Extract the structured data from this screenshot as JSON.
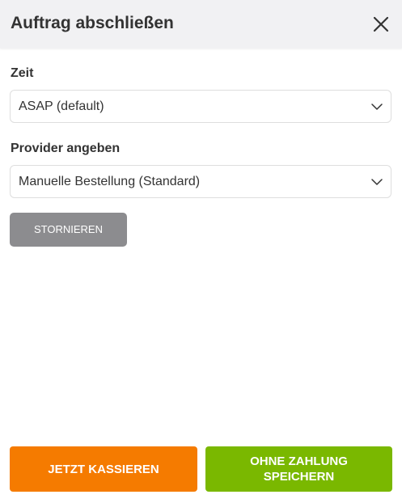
{
  "header": {
    "title": "Auftrag abschließen",
    "close_icon": "close-icon"
  },
  "time_field": {
    "label": "Zeit",
    "value": "ASAP (default)",
    "chevron_icon": "chevron-down-icon"
  },
  "provider_field": {
    "label": "Provider angeben",
    "value": "Manuelle Bestellung (Standard)",
    "chevron_icon": "chevron-down-icon"
  },
  "actions": {
    "cancel_label": "STORNIEREN",
    "pay_label": "JETZT KASSIEREN",
    "save_without_payment_label": "OHNE ZAHLUNG SPEICHERN"
  },
  "colors": {
    "header_bg": "#f1f1f3",
    "cancel_bg": "#8c8c8f",
    "pay_bg": "#f57b00",
    "save_bg": "#7ab800",
    "text": "#333333",
    "border": "#dedede"
  }
}
